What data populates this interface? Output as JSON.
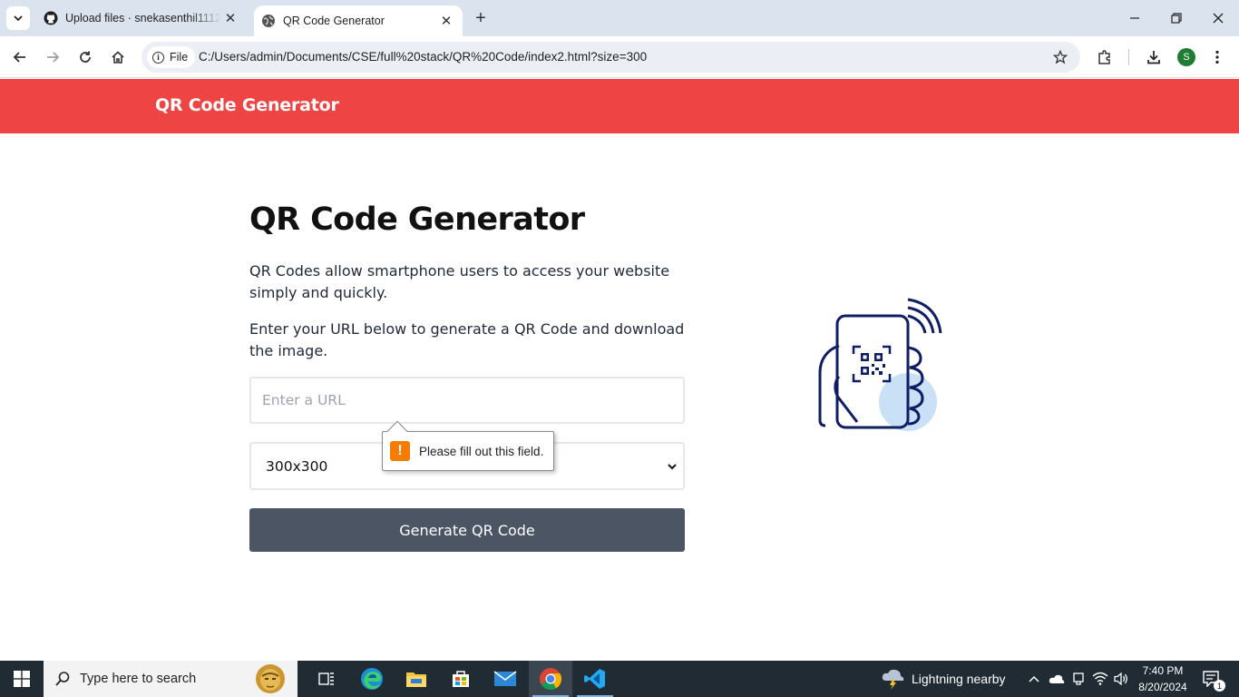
{
  "browser": {
    "tabs": [
      {
        "title": "Upload files · snekasenthil1112/",
        "favicon": "github-icon",
        "active": false
      },
      {
        "title": "QR Code Generator",
        "favicon": "globe-icon",
        "active": true
      }
    ],
    "new_tab_label": "+",
    "chip_label": "File",
    "url": "C:/Users/admin/Documents/CSE/full%20stack/QR%20Code/index2.html?size=300",
    "profile_initial": "S"
  },
  "page": {
    "brand": "QR Code Generator",
    "title": "QR Code Generator",
    "paragraph1": "QR Codes allow smartphone users to access your website simply and quickly.",
    "paragraph2": "Enter your URL below to generate a QR Code and download the image.",
    "url_input": {
      "placeholder": "Enter a URL",
      "value": ""
    },
    "size_select": {
      "selected": "300x300"
    },
    "generate_button": "Generate QR Code",
    "validation_tooltip": "Please fill out this field.",
    "colors": {
      "header": "#ef4444",
      "button": "#4b5563",
      "warning": "#f57c00"
    }
  },
  "taskbar": {
    "search_placeholder": "Type here to search",
    "weather": "Lightning nearby",
    "time": "7:40 PM",
    "date": "8/20/2024",
    "notification_count": "1",
    "apps": [
      "task-view-icon",
      "edge-icon",
      "file-explorer-icon",
      "microsoft-store-icon",
      "mail-icon",
      "chrome-icon",
      "vscode-icon"
    ]
  }
}
